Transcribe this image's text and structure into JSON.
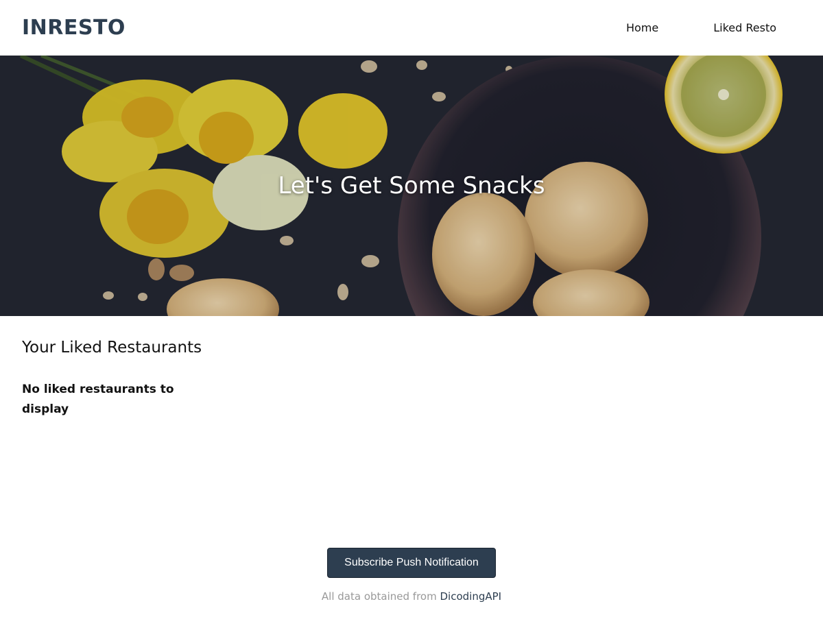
{
  "header": {
    "brand": "INRESTO",
    "nav": [
      {
        "label": "Home"
      },
      {
        "label": "Liked Resto"
      }
    ]
  },
  "hero": {
    "title": "Let's Get Some Snacks"
  },
  "main": {
    "section_title": "Your Liked Restaurants",
    "empty_message": "No liked restaurants to display"
  },
  "footer": {
    "subscribe_label": "Subscribe Push Notification",
    "credit_prefix": "All data obtained from",
    "credit_link": "DicodingAPI"
  },
  "colors": {
    "brand": "#2d3e50",
    "button_bg": "#2d3e50",
    "footer_text": "#999999"
  }
}
